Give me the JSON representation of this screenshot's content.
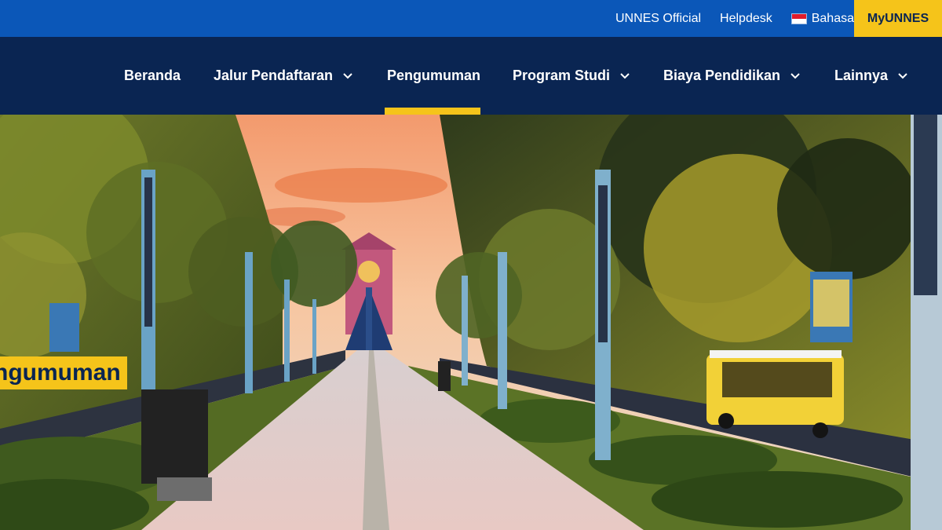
{
  "topbar": {
    "official_label": "UNNES Official",
    "helpdesk_label": "Helpdesk",
    "language_label": "Bahasa",
    "language_flag_icon": "indonesia-flag-icon",
    "myunnes_label": "MyUNNES"
  },
  "nav": {
    "items": [
      {
        "label": "Beranda",
        "has_dropdown": false
      },
      {
        "label": "Jalur Pendaftaran",
        "has_dropdown": true
      },
      {
        "label": "Pengumuman",
        "has_dropdown": false,
        "active": true
      },
      {
        "label": "Program Studi",
        "has_dropdown": true
      },
      {
        "label": "Biaya Pendidikan",
        "has_dropdown": true
      },
      {
        "label": "Lainnya",
        "has_dropdown": true
      }
    ]
  },
  "hero": {
    "page_label": "ngumuman"
  },
  "colors": {
    "topbar": "#0b57b8",
    "nav": "#0a2552",
    "accent": "#f5c41a"
  }
}
